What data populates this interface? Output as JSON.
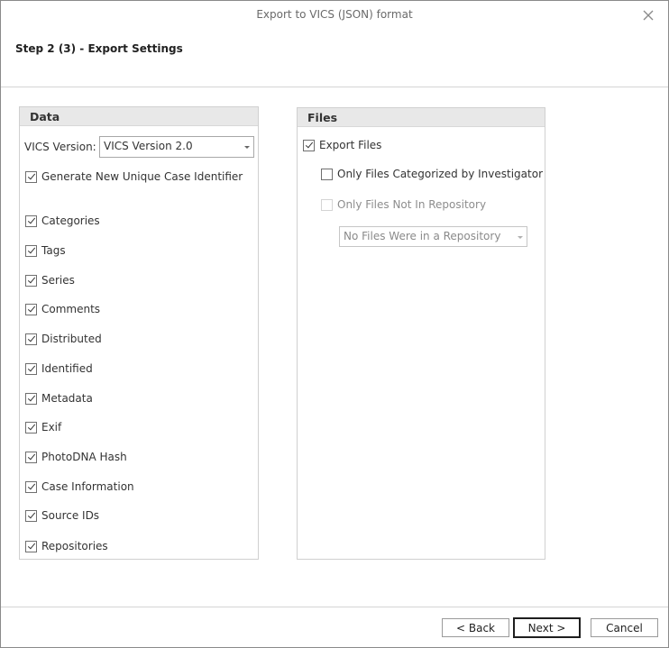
{
  "window": {
    "title": "Export to VICS (JSON) format"
  },
  "step": {
    "title": "Step 2 (3) - Export Settings"
  },
  "data_group": {
    "header": "Data",
    "version_label": "VICS Version:",
    "version_value": "VICS Version 2.0",
    "generate_id": {
      "label": "Generate New Unique Case Identifier",
      "checked": true
    },
    "items": [
      {
        "label": "Categories",
        "checked": true
      },
      {
        "label": "Tags",
        "checked": true
      },
      {
        "label": "Series",
        "checked": true
      },
      {
        "label": "Comments",
        "checked": true
      },
      {
        "label": "Distributed",
        "checked": true
      },
      {
        "label": "Identified",
        "checked": true
      },
      {
        "label": "Metadata",
        "checked": true
      },
      {
        "label": "Exif",
        "checked": true
      },
      {
        "label": "PhotoDNA Hash",
        "checked": true
      },
      {
        "label": "Case Information",
        "checked": true
      },
      {
        "label": "Source IDs",
        "checked": true
      },
      {
        "label": "Repositories",
        "checked": true
      }
    ]
  },
  "files_group": {
    "header": "Files",
    "export_files": {
      "label": "Export Files",
      "checked": true
    },
    "only_categorized": {
      "label": "Only Files Categorized by Investigator",
      "checked": false
    },
    "only_not_in_repo": {
      "label": "Only Files Not In Repository",
      "checked": false,
      "disabled": true
    },
    "repository_select_value": "No Files Were in a Repository"
  },
  "buttons": {
    "back": "< Back",
    "next": "Next >",
    "cancel": "Cancel"
  }
}
